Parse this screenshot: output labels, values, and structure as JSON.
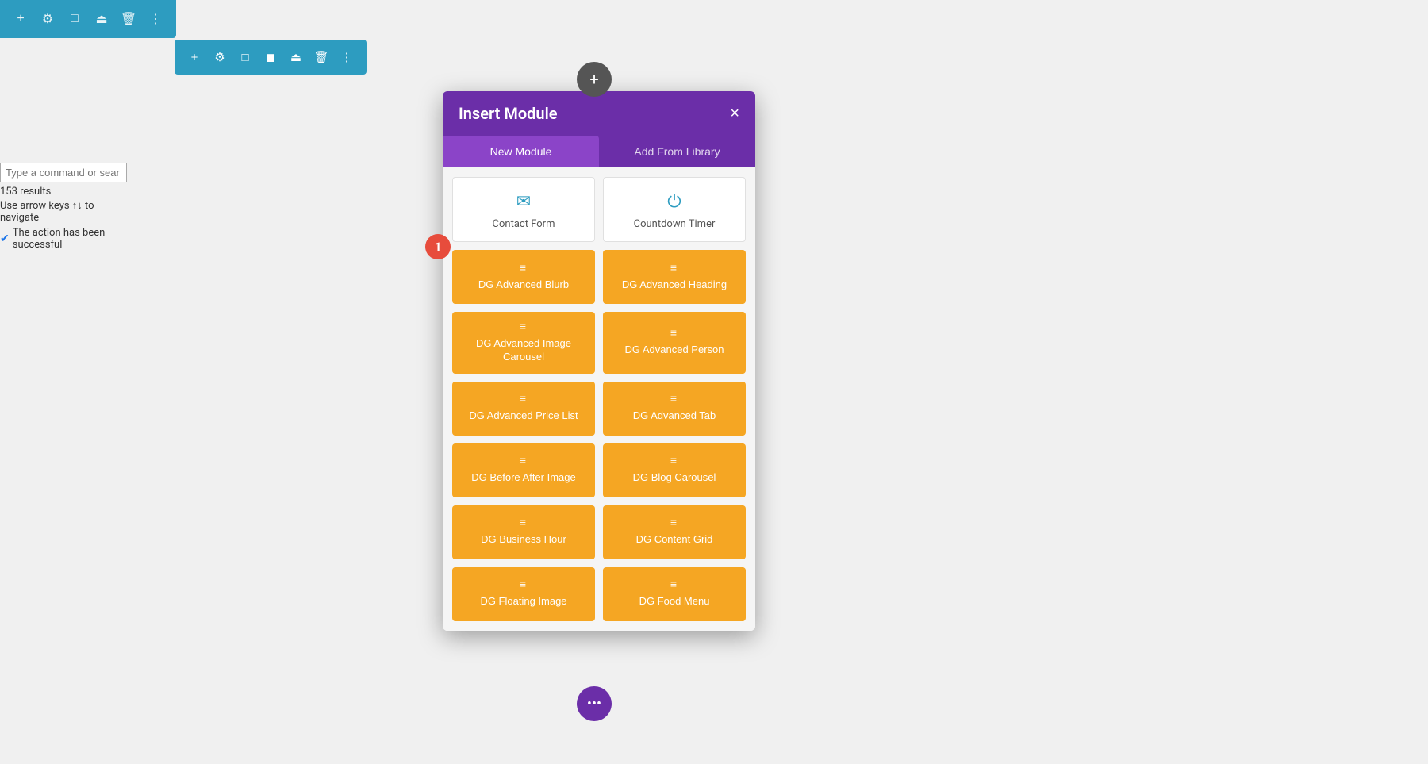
{
  "topToolbar": {
    "icons": [
      "plus",
      "gear",
      "layout",
      "power",
      "trash",
      "more"
    ]
  },
  "secondaryToolbar": {
    "icons": [
      "plus",
      "gear",
      "layout",
      "grid",
      "power",
      "trash",
      "more"
    ]
  },
  "searchPanel": {
    "placeholder": "Type a command or sear",
    "resultCount": "153 results",
    "navigateHint": "Use arrow keys ↑↓ to navigate",
    "successMessage": "The action has been successful"
  },
  "addCircleTop": {
    "label": "+"
  },
  "modal": {
    "title": "Insert Module",
    "closeLabel": "×",
    "tabs": [
      {
        "id": "new-module",
        "label": "New Module",
        "active": true
      },
      {
        "id": "add-from-library",
        "label": "Add From Library",
        "active": false
      }
    ],
    "specialModules": [
      {
        "id": "contact-form",
        "icon": "✉",
        "label": "Contact Form"
      },
      {
        "id": "countdown-timer",
        "icon": "⏻",
        "label": "Countdown Timer"
      }
    ],
    "orangeModules": [
      {
        "id": "dg-advanced-blurb",
        "label": "DG Advanced Blurb"
      },
      {
        "id": "dg-advanced-heading",
        "label": "DG Advanced Heading"
      },
      {
        "id": "dg-advanced-image-carousel",
        "label": "DG Advanced Image Carousel"
      },
      {
        "id": "dg-advanced-person",
        "label": "DG Advanced Person"
      },
      {
        "id": "dg-advanced-price-list",
        "label": "DG Advanced Price List"
      },
      {
        "id": "dg-advanced-tab",
        "label": "DG Advanced Tab"
      },
      {
        "id": "dg-before-after-image",
        "label": "DG Before After Image"
      },
      {
        "id": "dg-blog-carousel",
        "label": "DG Blog Carousel"
      },
      {
        "id": "dg-business-hour",
        "label": "DG Business Hour"
      },
      {
        "id": "dg-content-grid",
        "label": "DG Content Grid"
      },
      {
        "id": "dg-floating-image",
        "label": "DG Floating Image"
      },
      {
        "id": "dg-food-menu",
        "label": "DG Food Menu"
      }
    ]
  },
  "stepBadge": {
    "number": "1"
  },
  "dotsCircle": {
    "label": "•••"
  }
}
